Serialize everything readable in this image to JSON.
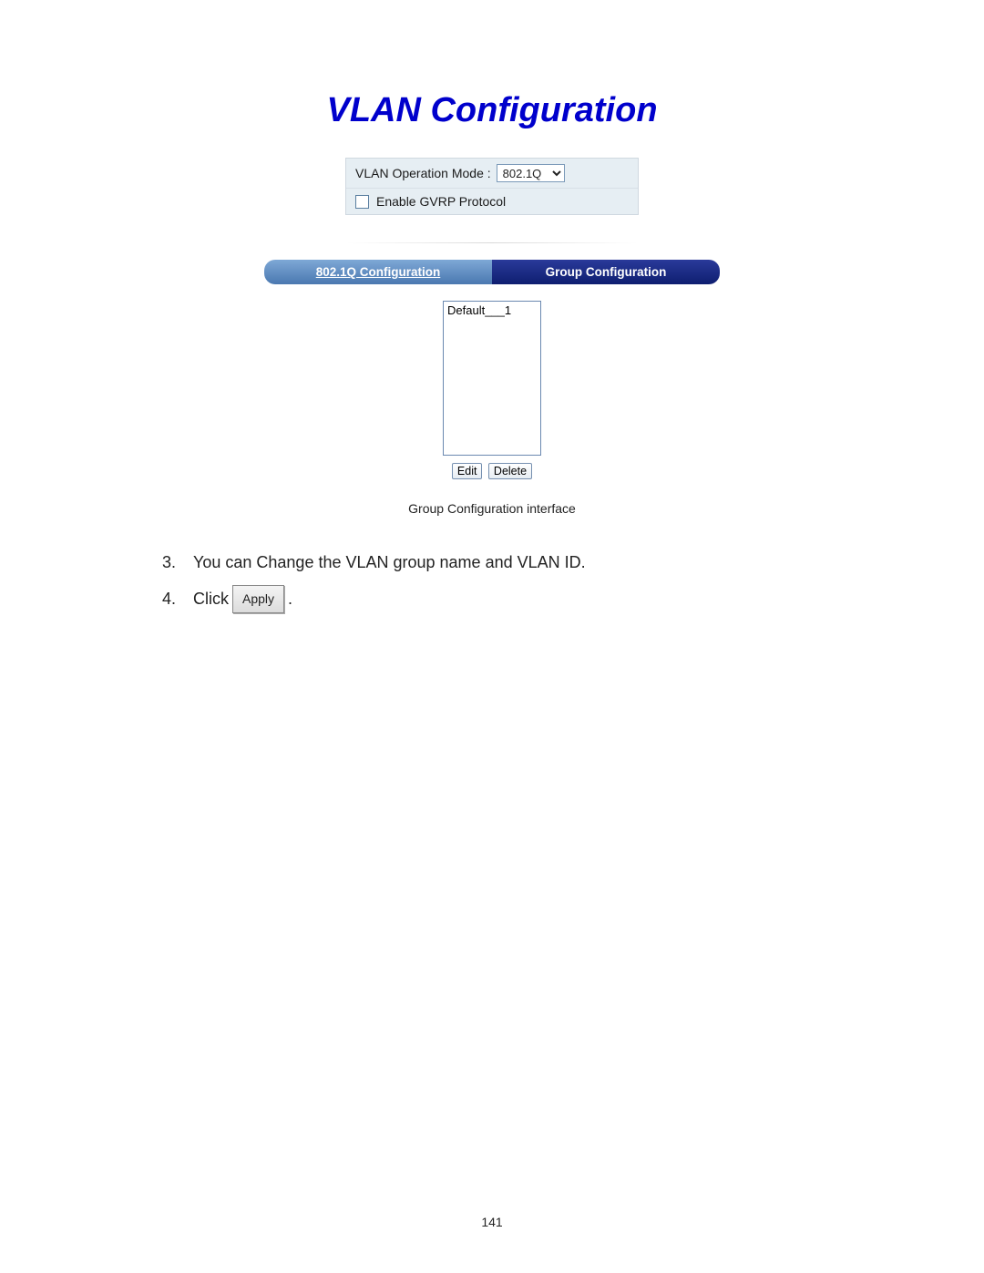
{
  "title": "VLAN Configuration",
  "options": {
    "mode_label": "VLAN Operation Mode :",
    "mode_value": "802.1Q",
    "gvrp_label": "Enable GVRP Protocol"
  },
  "tabs": {
    "left": "802.1Q Configuration",
    "right": "Group Configuration"
  },
  "list": {
    "items": [
      "Default___1"
    ]
  },
  "buttons": {
    "edit": "Edit",
    "delete": "Delete"
  },
  "caption": "Group Configuration interface",
  "steps": {
    "s3_num": "3.",
    "s3_text": "You can Change the VLAN group name and VLAN ID.",
    "s4_num": "4.",
    "s4_pre": "Click",
    "s4_btn": "Apply",
    "s4_post": "."
  },
  "page_number": "141"
}
